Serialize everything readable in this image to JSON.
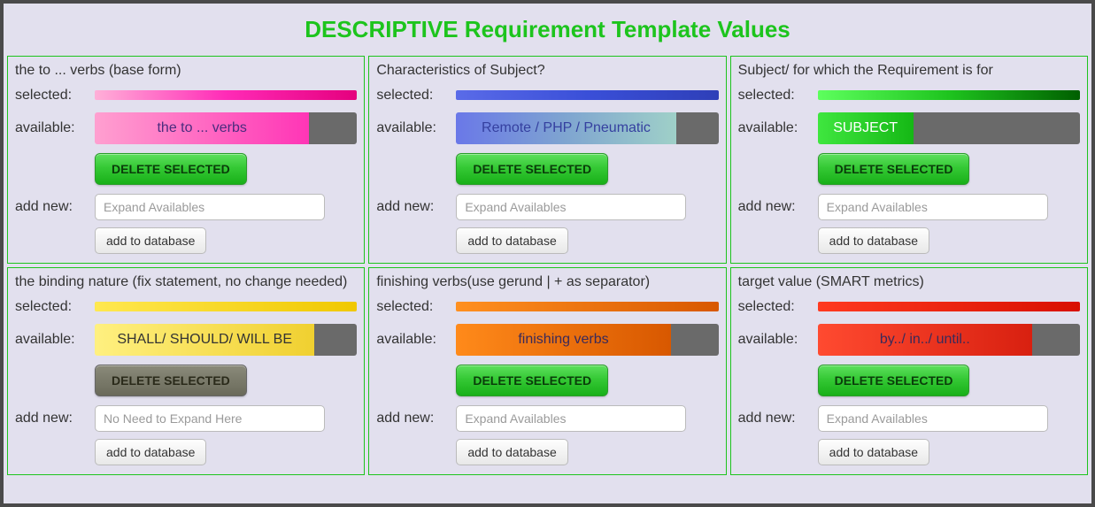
{
  "page_title": "DESCRIPTIVE Requirement Template Values",
  "labels": {
    "selected": "selected:",
    "available": "available:",
    "add_new": "add new:",
    "delete": "DELETE SELECTED",
    "add_db": "add to database"
  },
  "panels": [
    {
      "title": "the to ... verbs (base form)",
      "available_text": "the to ... verbs",
      "placeholder": "Expand Availables",
      "theme": "pink",
      "delete_disabled": false,
      "avail_style": ""
    },
    {
      "title": "Characteristics of Subject?",
      "available_text": "Remote / PHP / Pneumatic",
      "placeholder": "Expand Availables",
      "theme": "blue",
      "delete_disabled": false,
      "avail_style": "avail-wide"
    },
    {
      "title": "Subject/ for which the Requirement is for",
      "available_text": "SUBJECT",
      "placeholder": "Expand Availables",
      "theme": "green",
      "delete_disabled": false,
      "avail_style": "avail-narrow"
    },
    {
      "title": "the binding nature (fix statement, no change needed)",
      "available_text": "SHALL/ SHOULD/ WILL BE",
      "placeholder": "No Need to Expand Here",
      "theme": "yellow",
      "delete_disabled": true,
      "avail_style": "avail-wide"
    },
    {
      "title": "finishing verbs(use gerund | + as separator)",
      "available_text": "finishing verbs",
      "placeholder": "Expand Availables",
      "theme": "orange",
      "delete_disabled": false,
      "avail_style": ""
    },
    {
      "title": "target value (SMART metrics)",
      "available_text": "by../ in../ until..",
      "placeholder": "Expand Availables",
      "theme": "red",
      "delete_disabled": false,
      "avail_style": ""
    }
  ]
}
